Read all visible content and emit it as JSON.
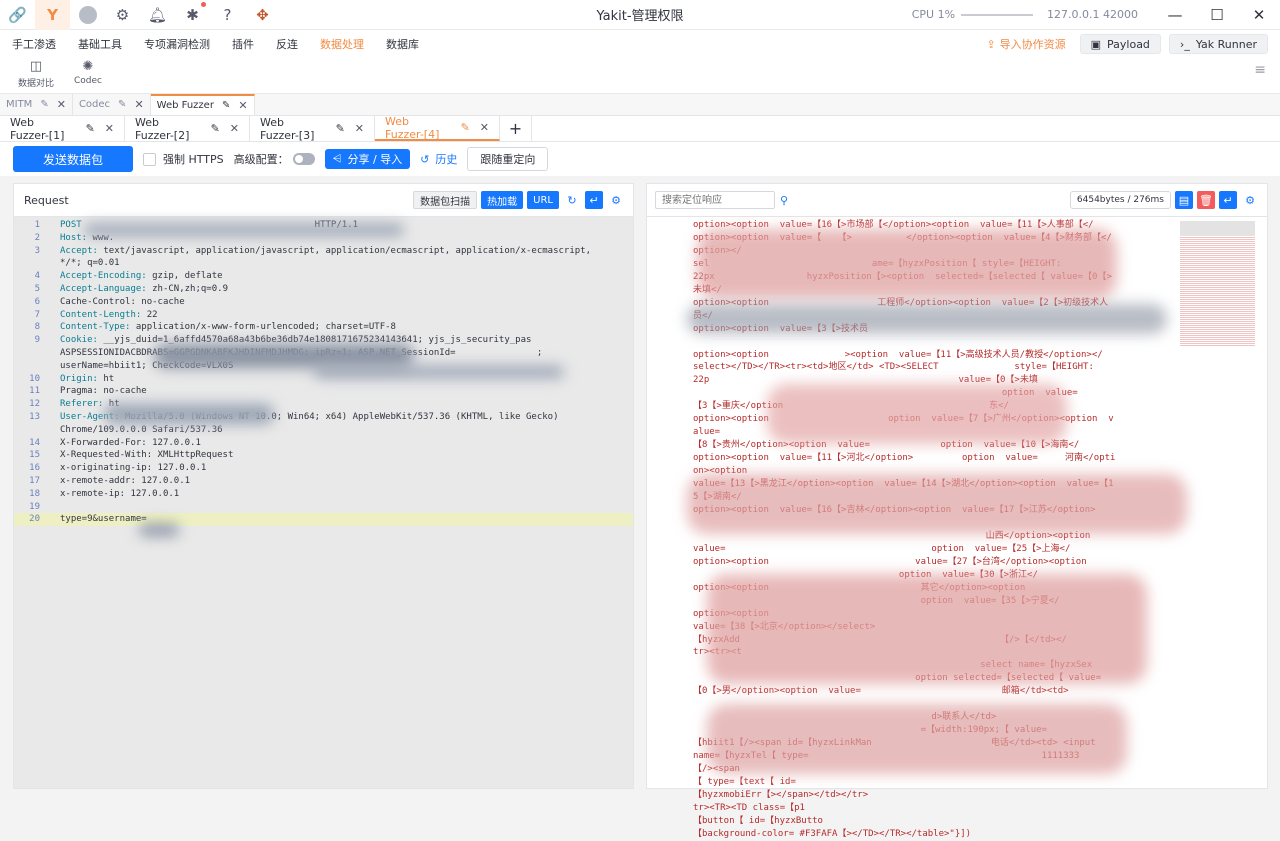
{
  "titlebar": {
    "title": "Yakit-管理权限",
    "icons": [
      "yakit-logo-icon",
      "yak-icon",
      "avatar-icon",
      "gear-icon",
      "bell-icon",
      "bug-icon",
      "help-icon",
      "plugin-icon"
    ],
    "cpu_label": "CPU 1%",
    "address": "127.0.0.1 42000"
  },
  "menu": {
    "items": [
      "手工渗透",
      "基础工具",
      "专项漏洞检测",
      "插件",
      "反连",
      "数据处理",
      "数据库"
    ],
    "active": "数据处理",
    "import_label": "导入协作资源",
    "payload_label": "Payload",
    "runner_label": "Yak Runner"
  },
  "tools": [
    {
      "label": "数据对比",
      "icon": "compare-icon"
    },
    {
      "label": "Codec",
      "icon": "codec-icon"
    }
  ],
  "tabs_level1": [
    {
      "label": "MITM"
    },
    {
      "label": "Codec"
    },
    {
      "label": "Web Fuzzer"
    }
  ],
  "tabs_level2": [
    {
      "label": "Web Fuzzer-[1]"
    },
    {
      "label": "Web Fuzzer-[2]"
    },
    {
      "label": "Web Fuzzer-[3]"
    },
    {
      "label": "Web Fuzzer-[4]"
    }
  ],
  "actions": {
    "send": "发送数据包",
    "force_https": "强制 HTTPS",
    "advanced": "高级配置：",
    "share": "分享 / 导入",
    "history": "历史",
    "redirect": "跟随重定向"
  },
  "request": {
    "title": "Request",
    "btn_scan": "数据包扫描",
    "btn_hotload": "热加载",
    "btn_url": "URL",
    "lines": [
      {
        "n": "1",
        "k": "POST ",
        "v": "                                          HTTP/1.1"
      },
      {
        "n": "2",
        "k": "Host: ",
        "v": "www."
      },
      {
        "n": "3",
        "k": "Accept: ",
        "v": "text/javascript, application/javascript, application/ecmascript, application/x-ecmascript, */*; q=0.01"
      },
      {
        "n": "4",
        "k": "Accept-Encoding: ",
        "v": "gzip, deflate"
      },
      {
        "n": "5",
        "k": "Accept-Language: ",
        "v": "zh-CN,zh;q=0.9"
      },
      {
        "n": "6",
        "k": "",
        "v": "Cache-Control: no-cache"
      },
      {
        "n": "7",
        "k": "Content-Length: ",
        "v": "22"
      },
      {
        "n": "8",
        "k": "Content-Type: ",
        "v": "application/x-www-form-urlencoded; charset=UTF-8"
      },
      {
        "n": "9",
        "k": "Cookie: ",
        "v": "__yjs_duid=1_6affd4570a68a43b6be36db74e1808171675234143641; yjs_js_security_pas                                      ASPSESSIONIDACBDRABS=GGPGDNKABFKJHDINFMDJHMDG; ipRz=1; ASP.NET_SessionId=               ; userName=hbiit1; CheckCode=VLX0S"
      },
      {
        "n": "10",
        "k": "Origin: ",
        "v": "ht"
      },
      {
        "n": "11",
        "k": "",
        "v": "Pragma: no-cache"
      },
      {
        "n": "12",
        "k": "Referer: ",
        "v": "ht"
      },
      {
        "n": "13",
        "k": "User-Agent: ",
        "v": "Mozilla/5.0 (Windows NT 10.0; Win64; x64) AppleWebKit/537.36 (KHTML, like Gecko) Chrome/109.0.0.0 Safari/537.36"
      },
      {
        "n": "14",
        "k": "",
        "v": "X-Forwarded-For: 127.0.0.1"
      },
      {
        "n": "15",
        "k": "",
        "v": "X-Requested-With: XMLHttpRequest"
      },
      {
        "n": "16",
        "k": "",
        "v": "x-originating-ip: 127.0.0.1"
      },
      {
        "n": "17",
        "k": "",
        "v": "x-remote-addr: 127.0.0.1"
      },
      {
        "n": "18",
        "k": "",
        "v": "x-remote-ip: 127.0.0.1"
      },
      {
        "n": "19",
        "k": "",
        "v": ""
      },
      {
        "n": "20",
        "k": "",
        "v": "type=9&username="
      }
    ]
  },
  "response": {
    "search_placeholder": "搜索定位响应",
    "stats": "6454bytes / 276ms",
    "body": "option><option  value=【16【>市场部【</option><option  value=【11【>人事部【</\noption><option  value=【   【>          </option><option  value=【4【>财务部【</option></\nsel                              ame=【hyzxPosition【 style=【HEIGHT:\n22px                 hyzxPosition【><option  selected=【selected【 value=【0【>未填</\noption><option                    工程师</option><option  value=【2【>初级技术人员</\noption><option  value=【3【>技术员     \n                                                                    \noption><option              ><option  value=【11【>高级技术人员/教授</option></\nselect></TD></TR><tr><td>地区</td> <TD><SELECT              style=【HEIGHT:\n22p                                              value=【0【>未填\n                                                         option  value=\n【3【>重庆</option                                      东</\noption><option                      option  value=【7【>广州</option><option  value=\n【8【>贵州</option><option  value=             option  value=【10【>海南</\noption><option  value=【11【>河北</option>         option  value=     河南</option><option\nvalue=【13【>黑龙江</option><option  value=【14【>湖北</option><option  value=【15【>湖南</\noption><option  value=【16【>吉林</option><option  value=【17【>江苏</option>\n                                                                    \n                                                      山西</option><option\nvalue=                                      option  value=【25【>上海</\noption><option                           value=【27【>台湾</option><option\n                                      option  value=【30【>浙江</\noption><option                            其它</option><option\n                                          option  value=【35【>宁夏</\noption><option                                                     \nvalue=【38【>北京</option></select>                                   \n【hyzxAdd                                                【/>【</td></\ntr><tr><t                                                            \n                                                     select name=【hyzxSex\n                                         option selected=【selected【 value=\n【0【>男</option><option  value=                          邮箱</td><td>\n                                                                    \n                                            d>联系人</td>\n                                          =【width:190px;【 value=\n【hbiit1【/><span id=【hyzxLinkMan                      电话</td><td> <input\nname=【hyzxTel【 type=                                           1111333\n【/><span                                                           \n【 type=【text【 id=                                                \n【hyzxmobiErr【></span></td></tr>                                   \ntr><TR><TD class=【p1                                               \n【button【 id=【hyzxButto                                           \n【background-color= #F3FAFA【></TD></TR></table>\"}])"
  }
}
